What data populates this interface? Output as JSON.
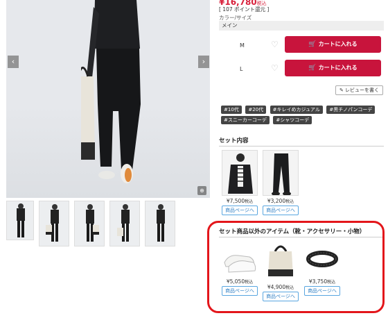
{
  "gallery": {
    "prev_icon": "chevron-left-icon",
    "next_icon": "chevron-right-icon",
    "zoom_icon": "zoom-icon",
    "prev_symbol": "‹",
    "next_symbol": "›",
    "zoom_symbol": "⊕",
    "thumbnail_count": 5
  },
  "product": {
    "price": "¥16,780",
    "tax_label": "税込",
    "points": "[ 107 ポイント還元 ]",
    "color_size_label": "カラー/サイズ",
    "color_name": "メイン",
    "sizes": [
      {
        "name": "M",
        "cart_label": "カートに入れる"
      },
      {
        "name": "L",
        "cart_label": "カートに入れる"
      }
    ],
    "heart_symbol": "♡",
    "cart_symbol": "🛒",
    "review_label": "レビューを書く",
    "review_symbol": "✎"
  },
  "tags": [
    "#10代",
    "#20代",
    "#キレイめカジュアル",
    "#黒チノパンコーデ",
    "#スニーカーコーデ",
    "#シャツコーデ"
  ],
  "set_items": {
    "title": "セット内容",
    "items": [
      {
        "price": "¥7,500",
        "tax": "税込",
        "link": "商品ページへ"
      },
      {
        "price": "¥3,200",
        "tax": "税込",
        "link": "商品ページへ"
      }
    ]
  },
  "other_items": {
    "title": "セット商品以外のアイテム（靴・アクセサリー・小物）",
    "items": [
      {
        "price": "¥5,050",
        "tax": "税込",
        "link": "商品ページへ"
      },
      {
        "price": "¥4,900",
        "tax": "税込",
        "link": "商品ページへ"
      },
      {
        "price": "¥3,750",
        "tax": "税込",
        "link": "商品ページへ"
      }
    ]
  },
  "colors": {
    "cart_red": "#c8143c",
    "price_red": "#d8203b",
    "link_blue": "#2f7fc4",
    "highlight_red": "#e3161b"
  }
}
